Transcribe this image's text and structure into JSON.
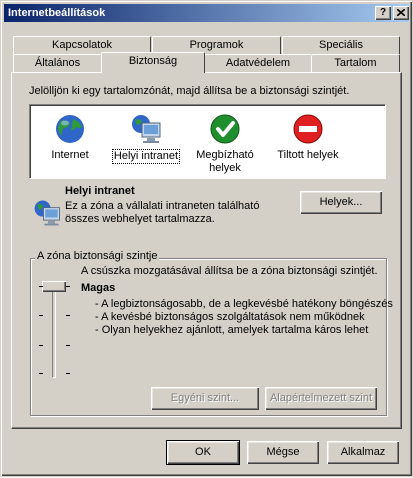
{
  "window": {
    "title": "Internetbeállítások",
    "help_button": "?",
    "close_button": "×"
  },
  "tabs_back": [
    "Kapcsolatok",
    "Programok",
    "Speciális"
  ],
  "tabs_front": [
    "Általános",
    "Biztonság",
    "Adatvédelem",
    "Tartalom"
  ],
  "active_tab": "Biztonság",
  "security": {
    "instruction": "Jelölljön ki egy tartalomzónát, majd állítsa be a biztonsági szintjét.",
    "zones": [
      {
        "label": "Internet",
        "icon": "globe-icon"
      },
      {
        "label": "Helyi intranet",
        "icon": "computer-globe-icon",
        "selected": true
      },
      {
        "label": "Megbízható helyek",
        "icon": "checkmark-icon"
      },
      {
        "label": "Tiltott helyek",
        "icon": "no-entry-icon"
      }
    ],
    "zone_title": "Helyi intranet",
    "zone_description": "Ez a zóna a vállalati intraneten található összes webhelyet tartalmazza.",
    "sites_button": "Helyek...",
    "group_label": "A zóna biztonsági szintje",
    "slider_hint": "A csúszka mozgatásával állítsa be a zóna biztonsági szintjét.",
    "level_name": "Magas",
    "level_bullets": [
      "- A legbiztonságosabb, de a legkevésbé hatékony böngészés",
      "- A kevésbé biztonságos szolgáltatások nem működnek",
      "- Olyan helyekhez ajánlott, amelyek tartalma káros lehet"
    ],
    "slider_level": "Magas",
    "custom_level_button": "Egyéni szint...",
    "default_level_button": "Alapértelmezett szint"
  },
  "footer": {
    "ok": "OK",
    "cancel": "Mégse",
    "apply": "Alkalmaz"
  },
  "colors": {
    "titlebar_start": "#0a246a",
    "titlebar_end": "#a6caf0",
    "face": "#d4d0c8"
  }
}
